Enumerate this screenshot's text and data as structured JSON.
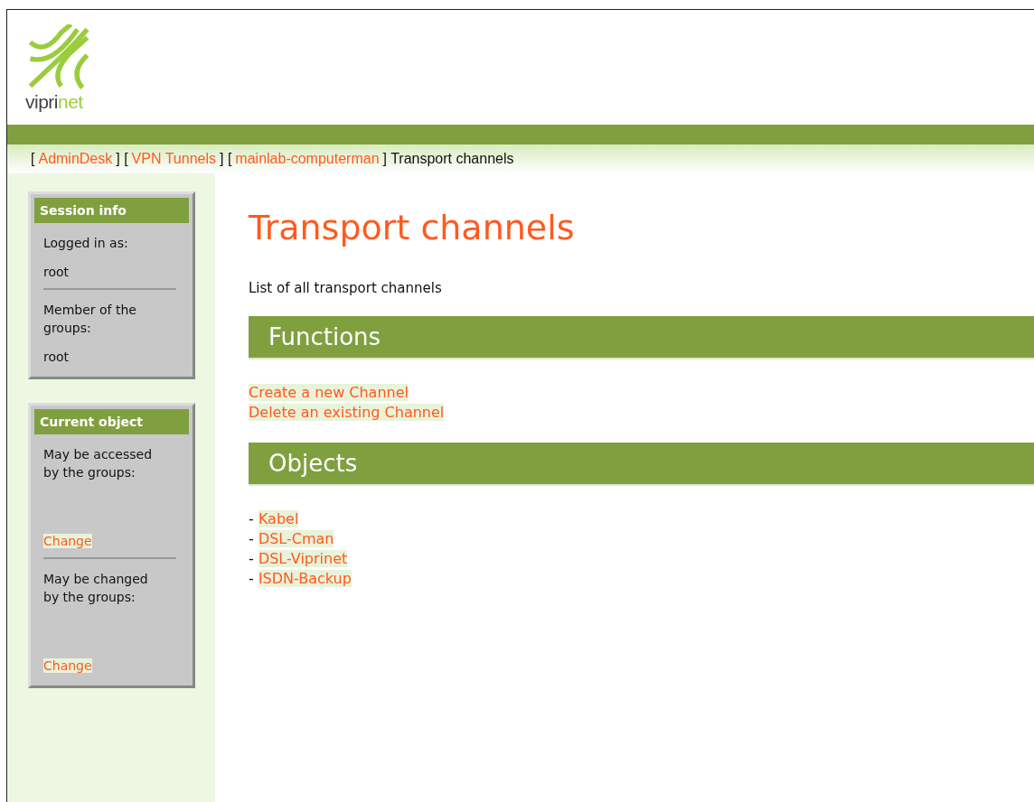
{
  "logo": {
    "dark": "vipri",
    "light": "net"
  },
  "breadcrumb": [
    {
      "kind": "text",
      "text": "["
    },
    {
      "kind": "link",
      "text": "AdminDesk"
    },
    {
      "kind": "text",
      "text": "] ["
    },
    {
      "kind": "link",
      "text": "VPN Tunnels"
    },
    {
      "kind": "text",
      "text": "] ["
    },
    {
      "kind": "link",
      "text": "mainlab-computerman"
    },
    {
      "kind": "text",
      "text": "] Transport channels"
    }
  ],
  "sidebar": [
    {
      "title": "Session info",
      "entries": [
        {
          "kind": "text",
          "text": "Logged in as:"
        },
        {
          "kind": "text",
          "text": "root"
        },
        {
          "kind": "divider"
        },
        {
          "kind": "text",
          "text": "Member of the groups:"
        },
        {
          "kind": "text",
          "text": "root"
        }
      ]
    },
    {
      "title": "Current object",
      "entries": [
        {
          "kind": "text",
          "text": "May be accessed by the groups:"
        },
        {
          "kind": "link",
          "text": "Change"
        },
        {
          "kind": "divider"
        },
        {
          "kind": "text",
          "text": "May be changed by the groups:"
        },
        {
          "kind": "link",
          "text": "Change"
        }
      ]
    }
  ],
  "page_title": "Transport channels",
  "description": "List of all transport channels",
  "functions": {
    "title": "Functions",
    "links": [
      "Create a new Channel",
      "Delete an existing Channel"
    ]
  },
  "objects": {
    "title": "Objects",
    "items": [
      {
        "marker": "-",
        "text": "Kabel"
      },
      {
        "marker": "-",
        "text": "DSL-Cman"
      },
      {
        "marker": "-",
        "text": "DSL-Viprinet"
      },
      {
        "marker": "-",
        "text": "ISDN-Backup"
      }
    ]
  }
}
